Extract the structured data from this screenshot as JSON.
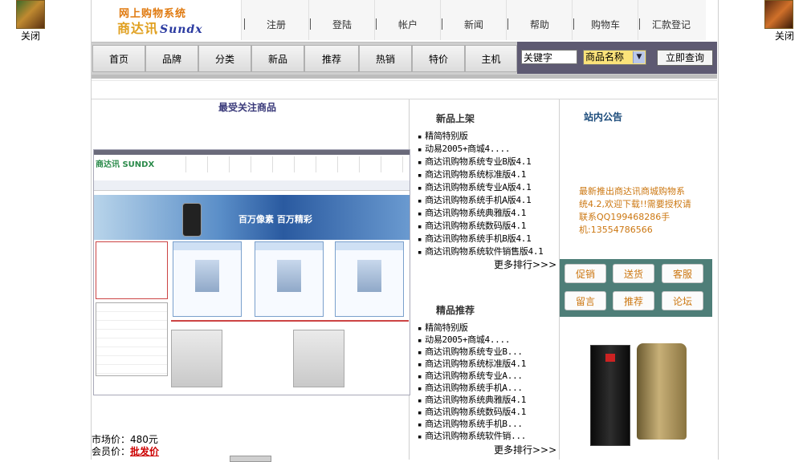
{
  "side_ads": {
    "left_close": "关闭",
    "right_close": "关闭"
  },
  "logo": {
    "line1": "网上购物系统",
    "line2_cn": "商达讯",
    "line2_en": "Sundx"
  },
  "top_nav": [
    "注册",
    "登陆",
    "帐户",
    "新闻",
    "帮助",
    "购物车",
    "汇款登记"
  ],
  "menu": [
    "首页",
    "品牌",
    "分类",
    "新品",
    "推荐",
    "热销",
    "特价",
    "主机"
  ],
  "search": {
    "keyword_value": "关键字",
    "select_value": "商品名称",
    "button": "立即查询"
  },
  "featured": {
    "title": "最受关注商品",
    "market_price": "市场价：480元",
    "member_price_label": "会员价：",
    "member_price_value": "批发价",
    "preview": {
      "logo": "商达讯 SUNDX",
      "banner_text": "百万像素 百万精彩"
    }
  },
  "new_products": {
    "title": "新品上架",
    "items": [
      "精简特别版",
      "动易2005+商城4....",
      "商达讯购物系统专业B版4.1",
      "商达讯购物系统标准版4.1",
      "商达讯购物系统专业A版4.1",
      "商达讯购物系统手机A版4.1",
      "商达讯购物系统典雅版4.1",
      "商达讯购物系统数码版4.1",
      "商达讯购物系统手机B版4.1",
      "商达讯购物系统软件销售版4.1"
    ],
    "more": "更多排行>>>"
  },
  "recommended": {
    "title": "精品推荐",
    "items": [
      "精简特别版",
      "动易2005+商城4....",
      "商达讯购物系统专业B...",
      "商达讯购物系统标准版4.1",
      "商达讯购物系统专业A...",
      "商达讯购物系统手机A...",
      "商达讯购物系统典雅版4.1",
      "商达讯购物系统数码版4.1",
      "商达讯购物系统手机B...",
      "商达讯购物系统软件销..."
    ],
    "more": "更多排行>>>"
  },
  "notice": {
    "title": "站内公告",
    "text": "最新推出商达讯商城购物系统4.2,欢迎下载!!需要授权请联系QQ199468286手机:13554786566"
  },
  "quick_buttons": [
    "促销",
    "送货",
    "客服",
    "留言",
    "推荐",
    "论坛"
  ],
  "colors": {
    "accent_orange": "#cc7711",
    "panel_teal": "#4e7e78",
    "search_bg": "#5e5a72"
  }
}
